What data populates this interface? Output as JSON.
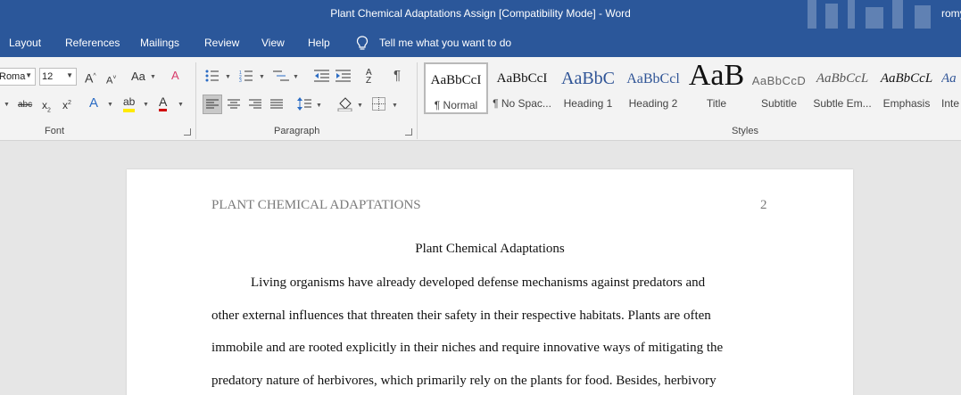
{
  "window": {
    "title": "Plant Chemical Adaptations Assign [Compatibility Mode]  -  Word",
    "user": "romy"
  },
  "menu": {
    "items": [
      "Layout",
      "References",
      "Mailings",
      "Review",
      "View",
      "Help"
    ],
    "tell_me": "Tell me what you want to do"
  },
  "ribbon": {
    "font": {
      "name_value": "Roma",
      "size_value": "12",
      "label": "Font"
    },
    "paragraph": {
      "label": "Paragraph"
    },
    "styles": {
      "label": "Styles",
      "items": [
        {
          "sample": "AaBbCcI",
          "name": "¶ Normal"
        },
        {
          "sample": "AaBbCcI",
          "name": "¶ No Spac..."
        },
        {
          "sample": "AaBbC",
          "name": "Heading 1"
        },
        {
          "sample": "AaBbCcl",
          "name": "Heading 2"
        },
        {
          "sample": "AaB",
          "name": "Title"
        },
        {
          "sample": "AaBbCcD",
          "name": "Subtitle"
        },
        {
          "sample": "AaBbCcL",
          "name": "Subtle Em..."
        },
        {
          "sample": "AaBbCcL",
          "name": "Emphasis"
        },
        {
          "sample": "Aa",
          "name": "Inte"
        }
      ]
    }
  },
  "document": {
    "header": "PLANT CHEMICAL ADAPTATIONS",
    "page_number": "2",
    "title": "Plant Chemical Adaptations",
    "lines": [
      "Living organisms have already developed defense mechanisms against predators and",
      "other external influences that threaten their safety in their respective habitats. Plants are often",
      "immobile and are rooted explicitly in their niches and require innovative ways of mitigating the",
      "predatory nature of herbivores, which primarily rely on the plants for food. Besides, herbivory"
    ]
  },
  "colors": {
    "title_bar": "#2b579a",
    "ribbon": "#f3f3f3",
    "canvas": "#e6e6e6"
  }
}
